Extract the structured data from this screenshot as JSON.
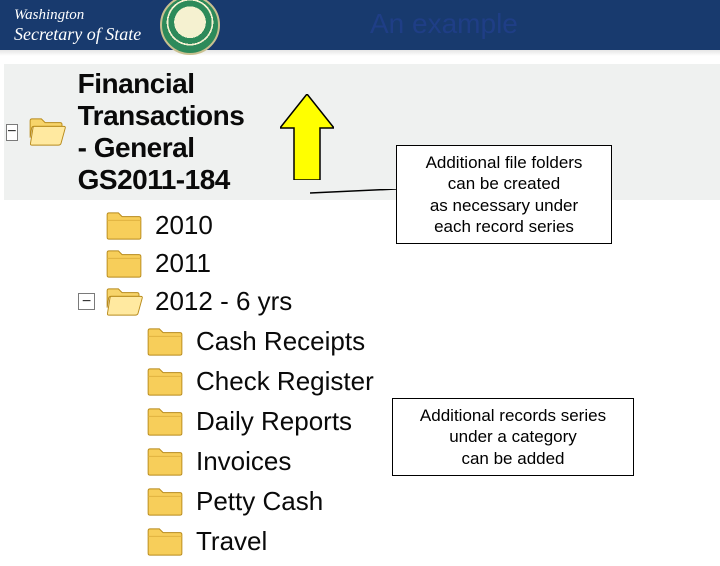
{
  "header": {
    "brand_line1": "Washington",
    "brand_line2": "Secretary of State",
    "title": "An example"
  },
  "tree": {
    "root": {
      "label": "Financial Transactions - General GS2011-184"
    },
    "children": [
      {
        "label": "2010"
      },
      {
        "label": "2011"
      },
      {
        "label": "2012 - 6 yrs",
        "children": [
          {
            "label": "Cash Receipts"
          },
          {
            "label": "Check Register"
          },
          {
            "label": "Daily Reports"
          },
          {
            "label": "Invoices"
          },
          {
            "label": "Petty Cash"
          },
          {
            "label": "Travel"
          }
        ]
      }
    ]
  },
  "callouts": {
    "c1_l1": "Additional file folders",
    "c1_l2": "can be created",
    "c1_l3": "as necessary under",
    "c1_l4": "each record series",
    "c2_l1": "Additional records series",
    "c2_l2": "under a category",
    "c2_l3": "can be added"
  },
  "icons": {
    "expander_glyph": "−"
  }
}
